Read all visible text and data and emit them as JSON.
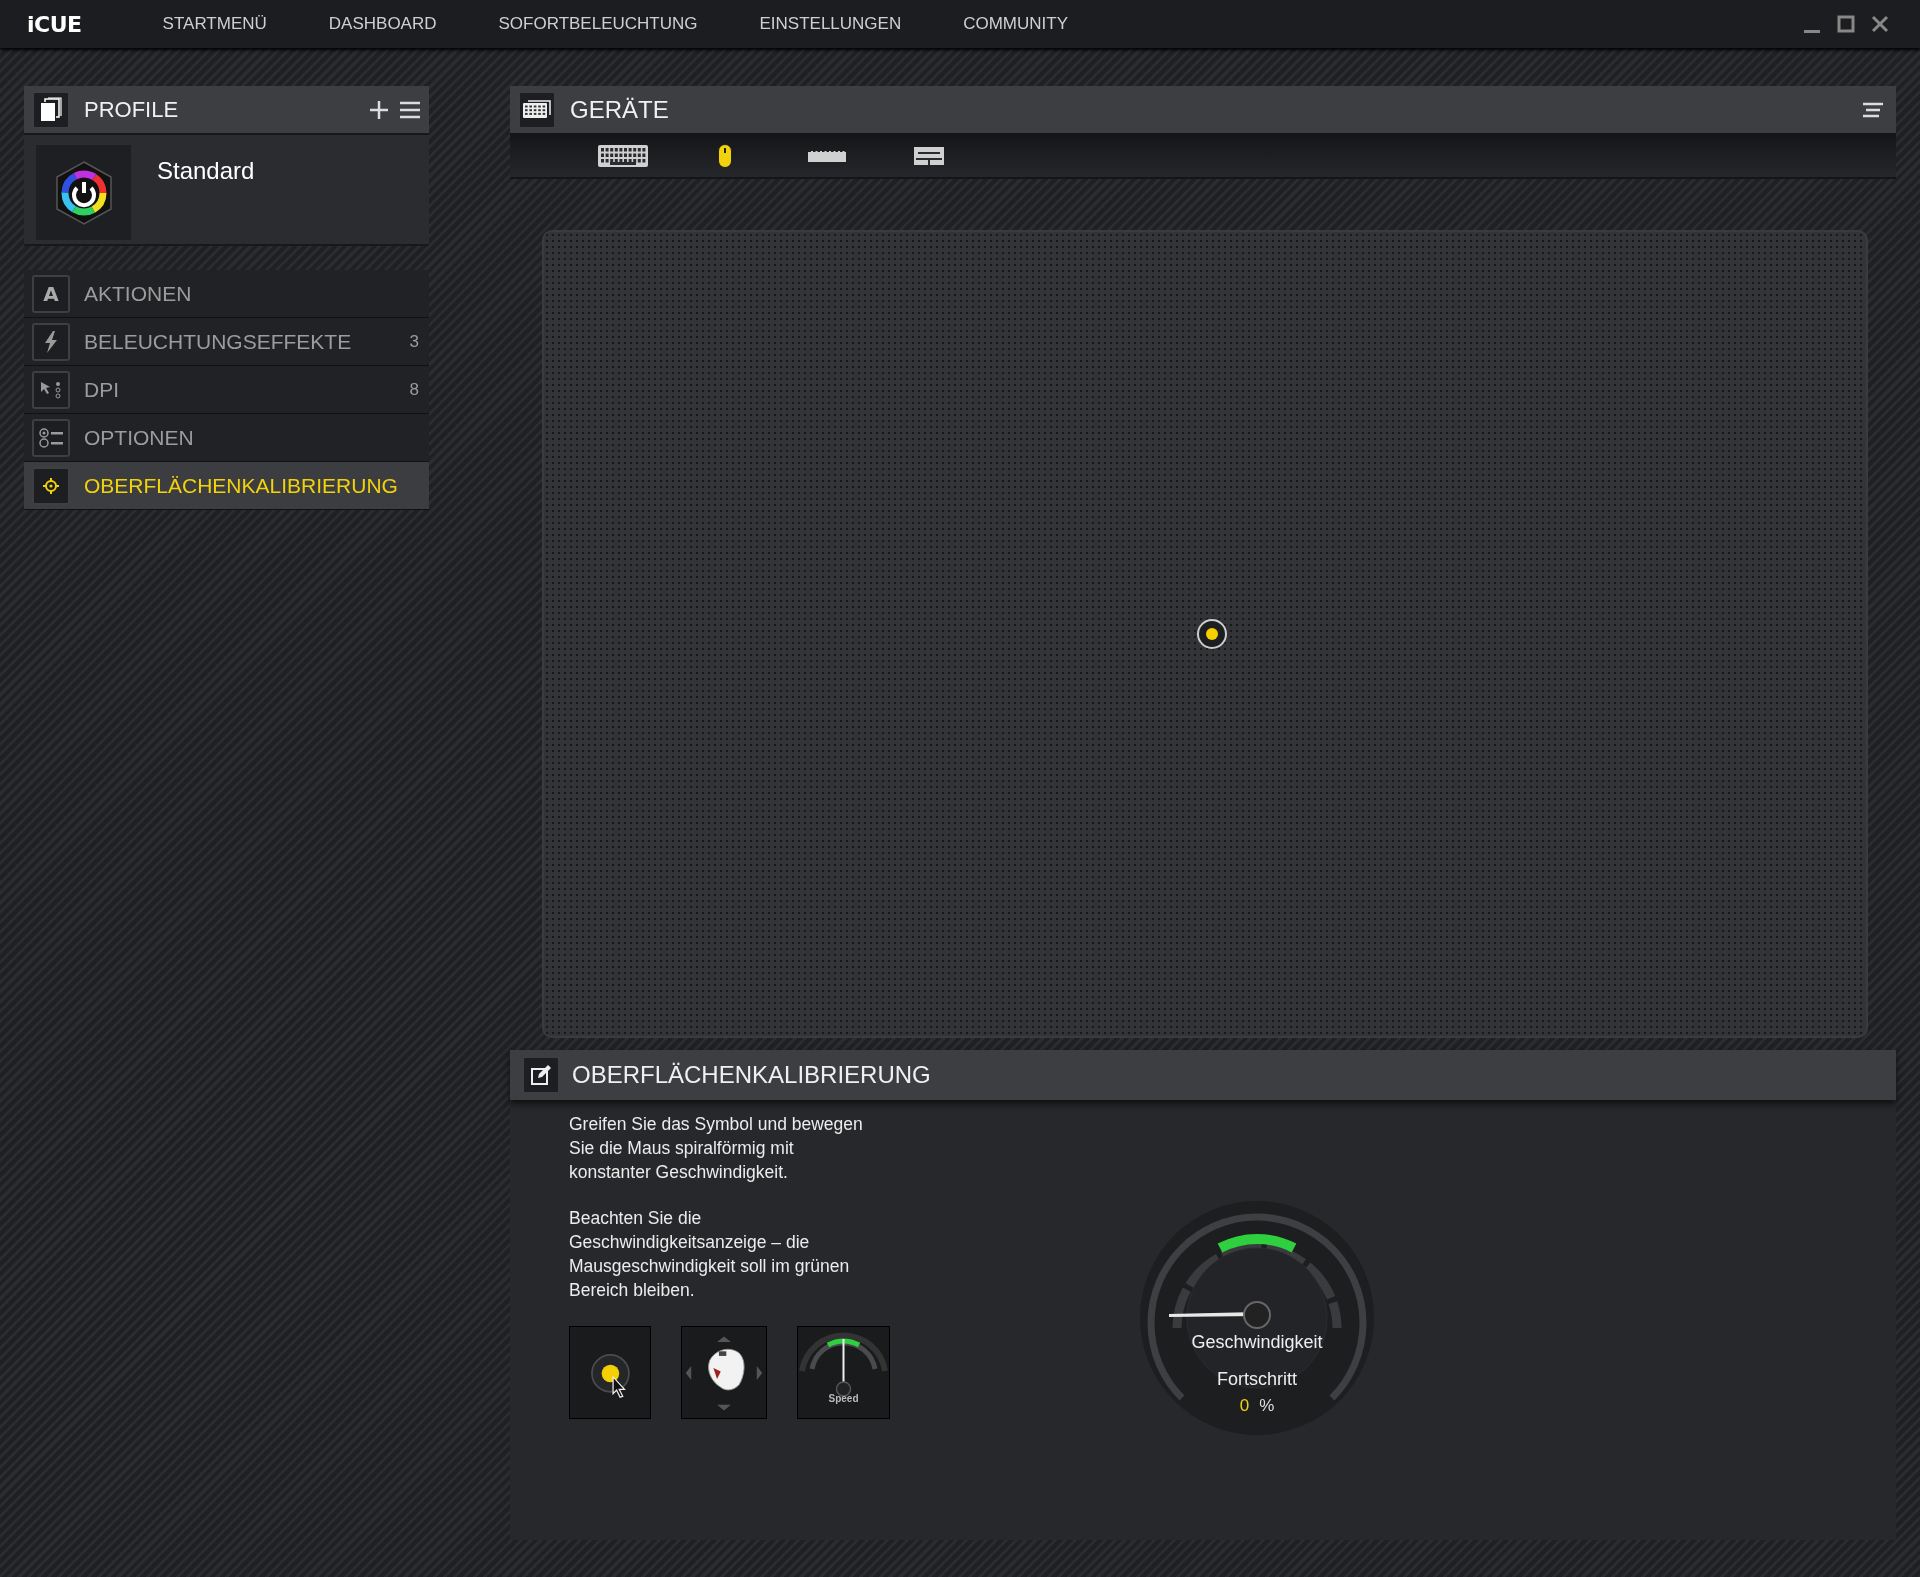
{
  "app": {
    "logo": "iCUE",
    "nav": [
      "STARTMENÜ",
      "DASHBOARD",
      "SOFORTBELEUCHTUNG",
      "EINSTELLUNGEN",
      "COMMUNITY"
    ]
  },
  "profiles": {
    "title": "PROFILE",
    "current": "Standard"
  },
  "sidebar": {
    "items": [
      {
        "kind": "actions",
        "icon_text": "A",
        "label": "AKTIONEN",
        "selected": false
      },
      {
        "kind": "lighting",
        "label": "BELEUCHTUNGSEFFEKTE",
        "count": "3",
        "selected": false
      },
      {
        "kind": "dpi",
        "label": "DPI",
        "count": "8",
        "selected": false
      },
      {
        "kind": "options",
        "label": "OPTIONEN",
        "selected": false
      },
      {
        "kind": "calibration",
        "label": "OBERFLÄCHENKALIBRIERUNG",
        "selected": true
      }
    ]
  },
  "devices": {
    "title": "GERÄTE",
    "tabs": [
      {
        "kind": "keyboard",
        "selected": false
      },
      {
        "kind": "mouse",
        "selected": true
      },
      {
        "kind": "strip",
        "selected": false
      },
      {
        "kind": "stand",
        "selected": false
      }
    ]
  },
  "calibration": {
    "title": "OBERFLÄCHENKALIBRIERUNG",
    "instructions": [
      "Greifen Sie das Symbol und bewegen Sie die Maus spiralförmig mit konstanter Geschwindigkeit.",
      "Beachten Sie die Geschwindigkeitsanzeige – die Mausgeschwindigkeit soll im grünen Bereich bleiben."
    ],
    "tiles": [
      {
        "kind": "target"
      },
      {
        "kind": "mouse"
      },
      {
        "kind": "speed",
        "label": "Speed"
      }
    ],
    "gauge": {
      "speed_label": "Geschwindigkeit",
      "progress_label": "Fortschritt",
      "progress_value": "0",
      "progress_unit": "%"
    }
  }
}
